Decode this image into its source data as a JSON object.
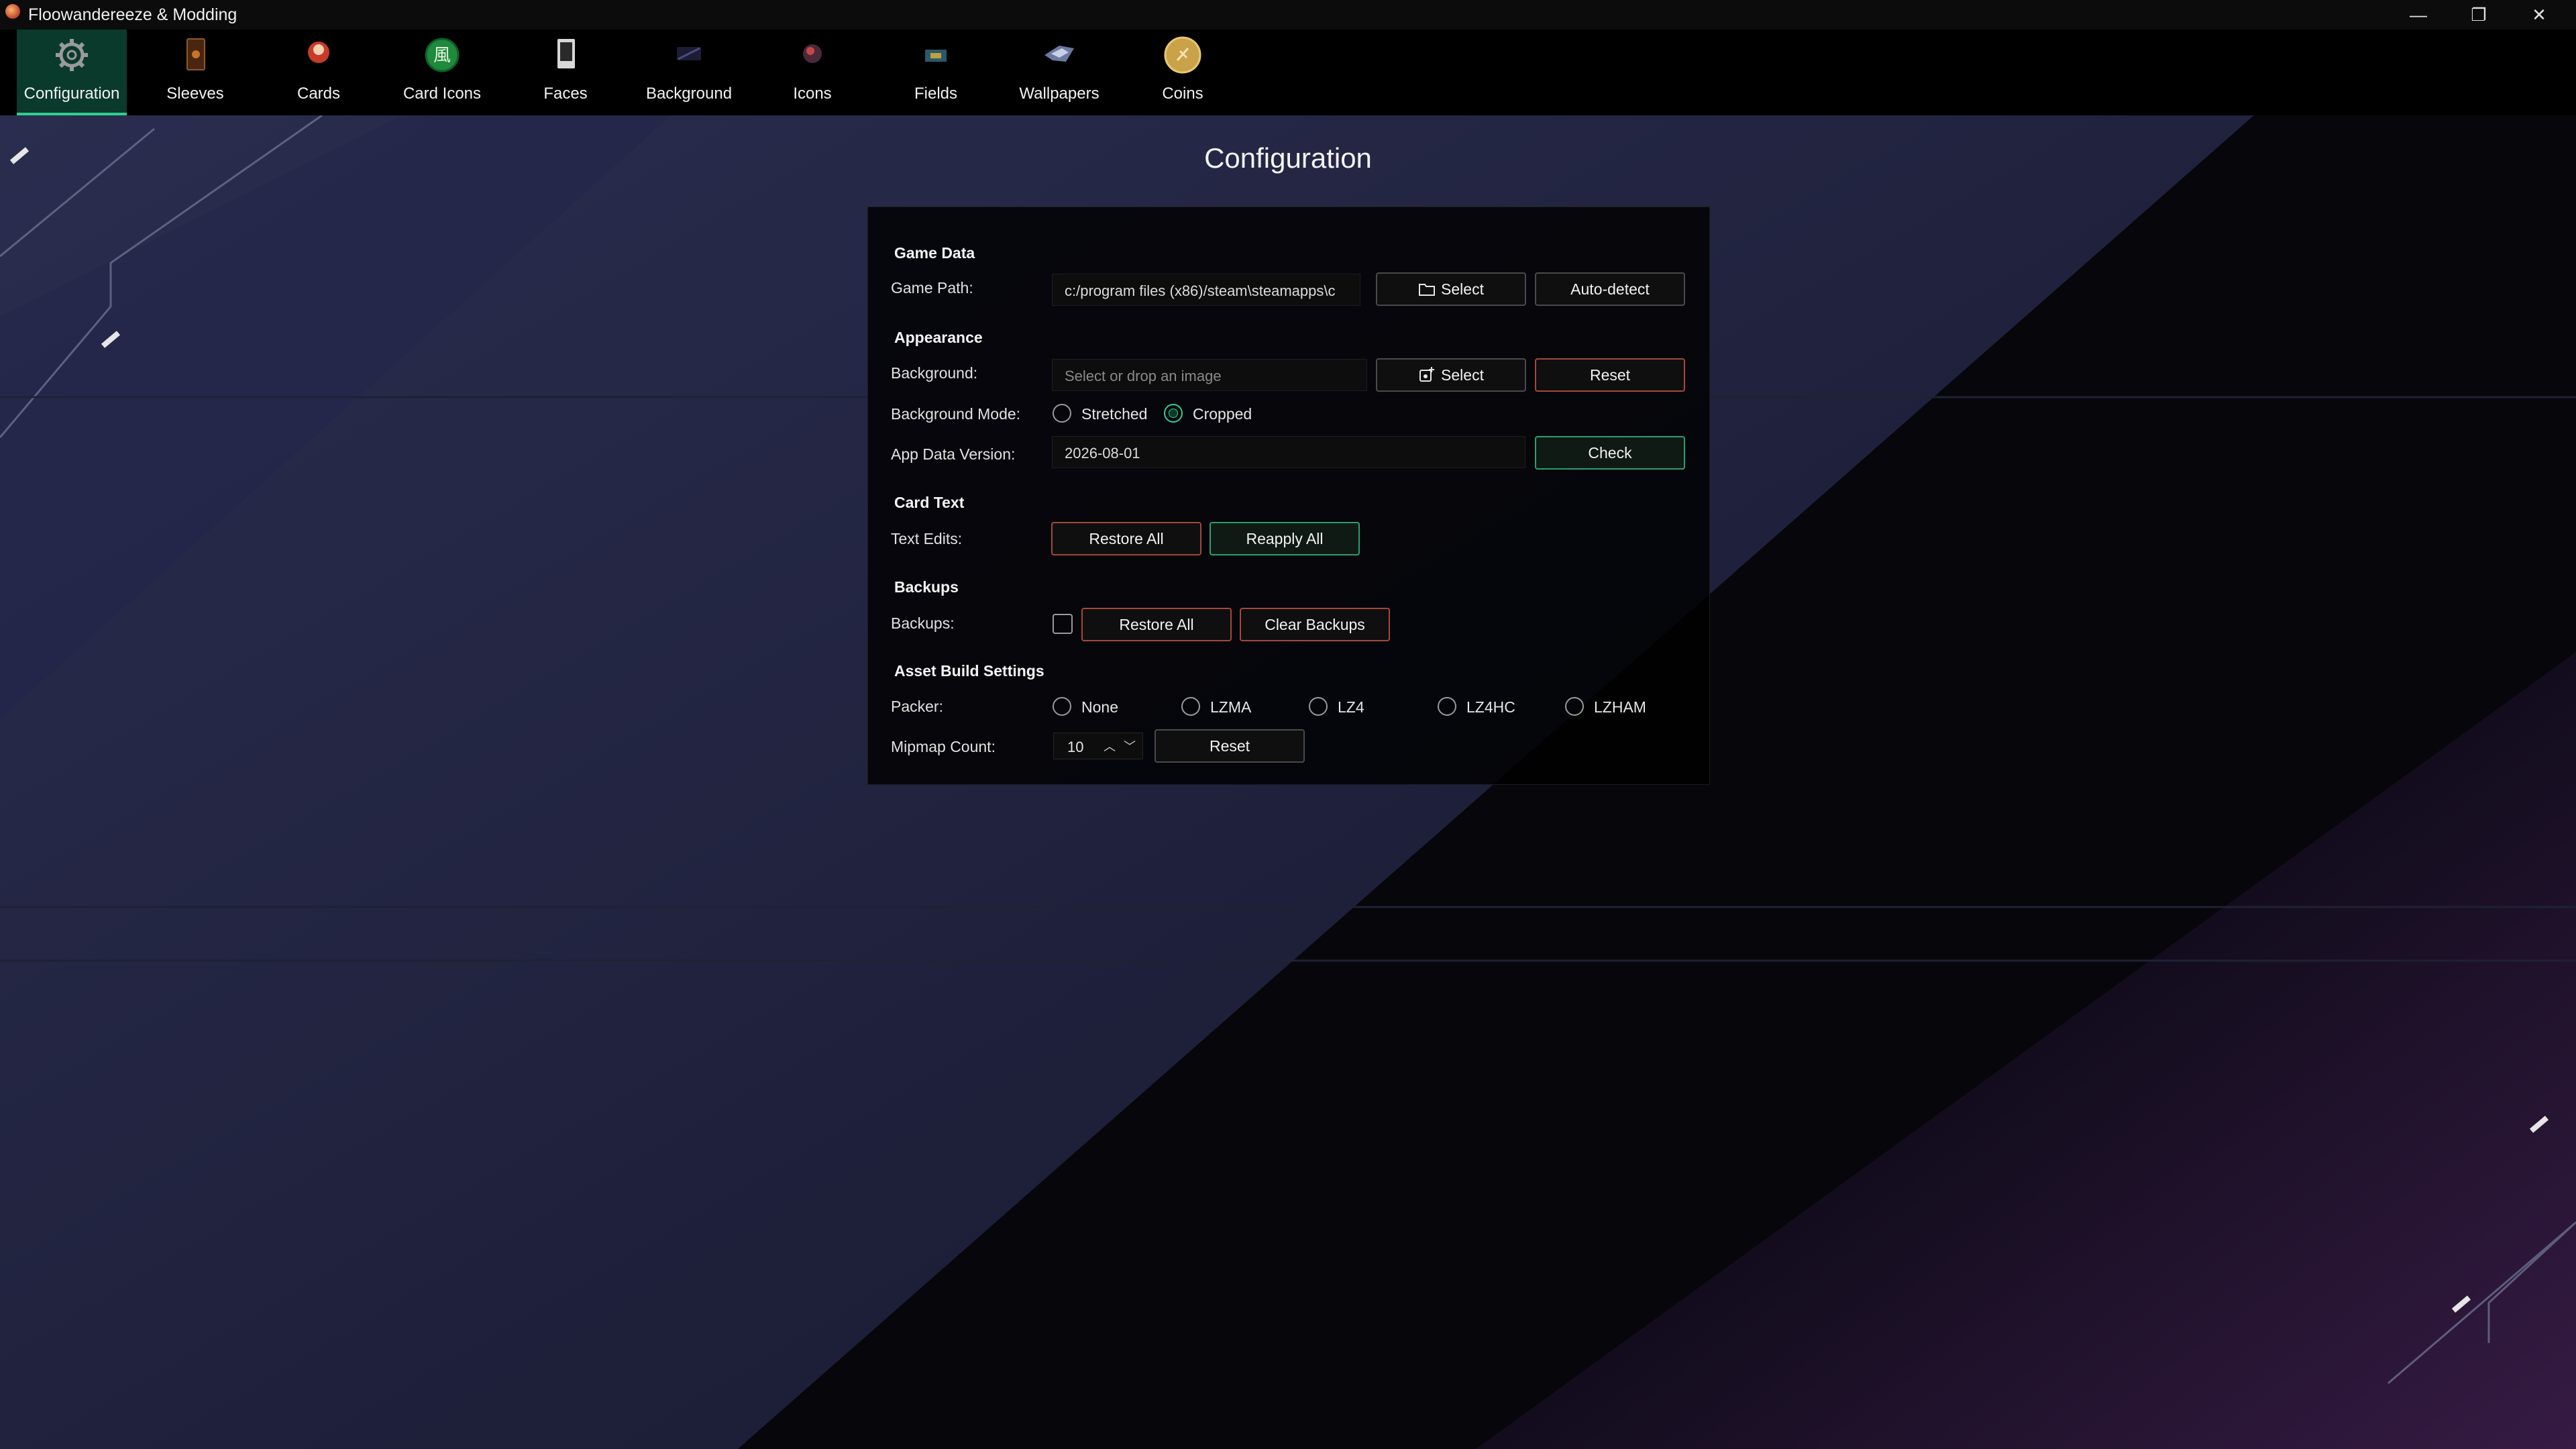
{
  "window": {
    "title": "Floowandereeze & Modding",
    "controls": {
      "minimize": "—",
      "restore": "❐",
      "close": "✕"
    }
  },
  "toolbar": {
    "items": [
      {
        "label": "Configuration",
        "icon": "gear-icon",
        "active": true
      },
      {
        "label": "Sleeves",
        "icon": "sleeve-icon"
      },
      {
        "label": "Cards",
        "icon": "card-monster-icon"
      },
      {
        "label": "Card Icons",
        "icon": "wind-attribute-icon"
      },
      {
        "label": "Faces",
        "icon": "card-face-icon"
      },
      {
        "label": "Background",
        "icon": "background-thumbnail-icon"
      },
      {
        "label": "Icons",
        "icon": "character-icon"
      },
      {
        "label": "Fields",
        "icon": "field-thumbnail-icon"
      },
      {
        "label": "Wallpapers",
        "icon": "wallpaper-thumbnail-icon"
      },
      {
        "label": "Coins",
        "icon": "coin-icon"
      }
    ]
  },
  "page": {
    "title": "Configuration"
  },
  "game_data": {
    "heading": "Game Data",
    "game_path_label": "Game Path:",
    "game_path_value": "c:/program files (x86)/steam\\steamapps\\c",
    "select_label": "Select",
    "auto_detect_label": "Auto-detect"
  },
  "appearance": {
    "heading": "Appearance",
    "background_label": "Background:",
    "background_placeholder": "Select or drop an image",
    "select_label": "Select",
    "reset_label": "Reset",
    "mode_label": "Background Mode:",
    "mode_options": [
      "Stretched",
      "Cropped"
    ],
    "mode_selected": "Cropped",
    "app_data_label": "App Data Version:",
    "app_data_value": "2026-08-01",
    "check_label": "Check"
  },
  "card_text": {
    "heading": "Card Text",
    "text_edits_label": "Text Edits:",
    "restore_all_label": "Restore All",
    "reapply_all_label": "Reapply All"
  },
  "backups": {
    "heading": "Backups",
    "backups_label": "Backups:",
    "enabled": false,
    "restore_all_label": "Restore All",
    "clear_label": "Clear Backups"
  },
  "asset_build": {
    "heading": "Asset Build Settings",
    "packer_label": "Packer:",
    "packer_options": [
      "None",
      "LZMA",
      "LZ4",
      "LZ4HC",
      "LZHAM"
    ],
    "packer_selected": null,
    "mipmap_label": "Mipmap Count:",
    "mipmap_value": "10",
    "reset_label": "Reset"
  },
  "colors": {
    "accent": "#2fd08c",
    "danger_border": "#a6473c",
    "active_tab": "#0a3a2c"
  }
}
